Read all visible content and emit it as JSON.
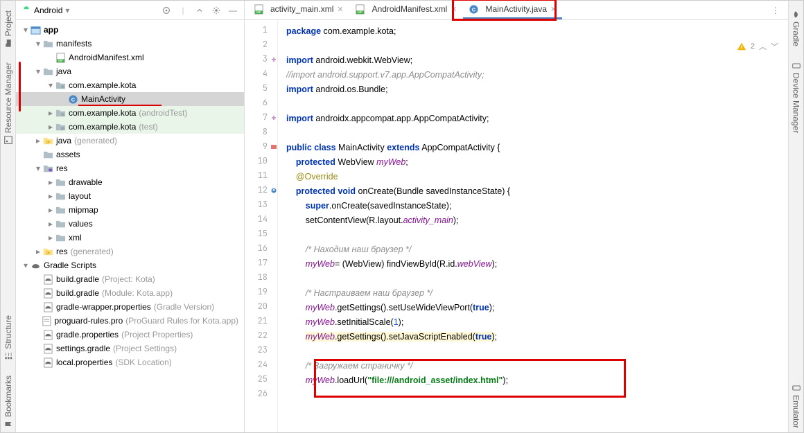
{
  "leftTabs": [
    "Project",
    "Resource Manager",
    "Structure",
    "Bookmarks"
  ],
  "rightTabs": [
    "Gradle",
    "Device Manager",
    "Emulator"
  ],
  "sidebarHead": {
    "title": "Android"
  },
  "status": {
    "warnings": "2"
  },
  "tabs": [
    {
      "label": "activity_main.xml",
      "type": "xml"
    },
    {
      "label": "AndroidManifest.xml",
      "type": "xml"
    },
    {
      "label": "MainActivity.java",
      "type": "java",
      "active": true
    }
  ],
  "tree": [
    {
      "d": 0,
      "c": "v",
      "icon": "mod",
      "text": "app",
      "bold": true
    },
    {
      "d": 1,
      "c": "v",
      "icon": "dir",
      "text": "manifests"
    },
    {
      "d": 2,
      "c": "",
      "icon": "mf",
      "text": "AndroidManifest.xml"
    },
    {
      "d": 1,
      "c": "v",
      "icon": "dir",
      "text": "java"
    },
    {
      "d": 2,
      "c": "v",
      "icon": "pkg",
      "text": "com.example.kota"
    },
    {
      "d": 3,
      "c": "",
      "icon": "cls",
      "text": "MainActivity",
      "sel": true
    },
    {
      "d": 2,
      "c": ">",
      "icon": "pkg",
      "text": "com.example.kota",
      "gray": "(androidTest)",
      "green": true
    },
    {
      "d": 2,
      "c": ">",
      "icon": "pkg",
      "text": "com.example.kota",
      "gray": "(test)",
      "green": true
    },
    {
      "d": 1,
      "c": ">",
      "icon": "gen",
      "text": "java",
      "gray": "(generated)"
    },
    {
      "d": 1,
      "c": "",
      "icon": "dir",
      "text": "assets"
    },
    {
      "d": 1,
      "c": "v",
      "icon": "res",
      "text": "res"
    },
    {
      "d": 2,
      "c": ">",
      "icon": "dir",
      "text": "drawable"
    },
    {
      "d": 2,
      "c": ">",
      "icon": "dir",
      "text": "layout"
    },
    {
      "d": 2,
      "c": ">",
      "icon": "dir",
      "text": "mipmap"
    },
    {
      "d": 2,
      "c": ">",
      "icon": "dir",
      "text": "values"
    },
    {
      "d": 2,
      "c": ">",
      "icon": "dir",
      "text": "xml"
    },
    {
      "d": 1,
      "c": ">",
      "icon": "gen",
      "text": "res",
      "gray": "(generated)"
    },
    {
      "d": 0,
      "c": "v",
      "icon": "gradle",
      "text": "Gradle Scripts"
    },
    {
      "d": 1,
      "c": "",
      "icon": "gf",
      "text": "build.gradle",
      "gray": "(Project: Kota)"
    },
    {
      "d": 1,
      "c": "",
      "icon": "gf",
      "text": "build.gradle",
      "gray": "(Module: Kota.app)"
    },
    {
      "d": 1,
      "c": "",
      "icon": "gf",
      "text": "gradle-wrapper.properties",
      "gray": "(Gradle Version)"
    },
    {
      "d": 1,
      "c": "",
      "icon": "pro",
      "text": "proguard-rules.pro",
      "gray": "(ProGuard Rules for Kota.app)"
    },
    {
      "d": 1,
      "c": "",
      "icon": "gf",
      "text": "gradle.properties",
      "gray": "(Project Properties)"
    },
    {
      "d": 1,
      "c": "",
      "icon": "gf",
      "text": "settings.gradle",
      "gray": "(Project Settings)"
    },
    {
      "d": 1,
      "c": "",
      "icon": "gf",
      "text": "local.properties",
      "gray": "(SDK Location)"
    }
  ],
  "lines": [
    {
      "n": 1,
      "html": "<span class='kw'>package</span> com.example.kota;"
    },
    {
      "n": 2,
      "html": ""
    },
    {
      "n": 3,
      "html": "<span class='kw'>import</span> android.webkit.WebView;",
      "mark": "plus"
    },
    {
      "n": 4,
      "html": "<span class='cmt'>//import android.support.v7.app.AppCompatActivity;</span>"
    },
    {
      "n": 5,
      "html": "<span class='kw'>import</span> android.os.Bundle;"
    },
    {
      "n": 6,
      "html": ""
    },
    {
      "n": 7,
      "html": "<span class='kw'>import</span> androidx.appcompat.app.AppCompatActivity;",
      "mark": "plus"
    },
    {
      "n": 8,
      "html": ""
    },
    {
      "n": 9,
      "html": "<span class='kw'>public class</span> MainActivity <span class='kw'>extends</span> AppCompatActivity {",
      "mark": "impl"
    },
    {
      "n": 10,
      "html": "    <span class='kw'>protected</span> WebView <span class='fld'>myWeb</span>;"
    },
    {
      "n": 11,
      "html": "    <span class='ann'>@Override</span>"
    },
    {
      "n": 12,
      "html": "    <span class='kw'>protected void</span> onCreate(Bundle savedInstanceState) {",
      "mark": "over"
    },
    {
      "n": 13,
      "html": "        <span class='kw'>super</span>.onCreate(savedInstanceState);"
    },
    {
      "n": 14,
      "html": "        setContentView(R.layout.<span class='fld'>activity_main</span>);"
    },
    {
      "n": 15,
      "html": ""
    },
    {
      "n": 16,
      "html": "        <span class='cmt'>/* Находим наш браузер */</span>"
    },
    {
      "n": 17,
      "html": "        <span class='fld'>myWeb</span>= (WebView) findViewById(R.id.<span class='fld'>webView</span>);"
    },
    {
      "n": 18,
      "html": ""
    },
    {
      "n": 19,
      "html": "        <span class='cmt'>/* Настраиваем наш браузер */</span>"
    },
    {
      "n": 20,
      "html": "        <span class='fld'>myWeb</span>.getSettings().setUseWideViewPort(<span class='kw'>true</span>);"
    },
    {
      "n": 21,
      "html": "        <span class='fld'>myWeb</span>.setInitialScale(<span class='num'>1</span>);"
    },
    {
      "n": 22,
      "html": "        <span class='hl-yellow'><span class='fld'>myWeb</span>.getSettings().setJavaScriptEnabled(<span class='kw'>true</span>)</span>;"
    },
    {
      "n": 23,
      "html": ""
    },
    {
      "n": 24,
      "html": "        <span class='cmt'>/* Загружаем страничку */</span>"
    },
    {
      "n": 25,
      "html": "        <span class='fld'>myWeb</span>.loadUrl(<span class='str'>\"file:///android_asset/index.html\"</span>);"
    },
    {
      "n": 26,
      "html": ""
    }
  ]
}
